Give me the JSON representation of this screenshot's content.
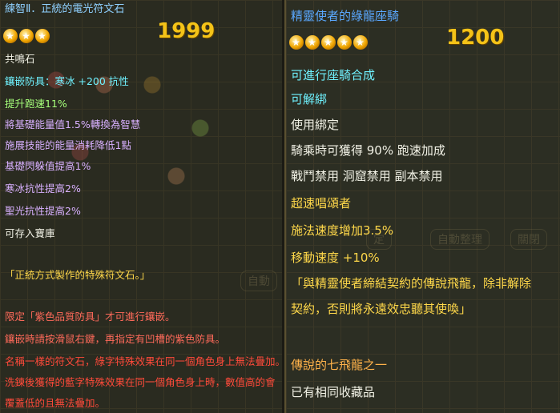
{
  "left": {
    "title": "練智Ⅱ．正統的電光符文石",
    "stars": 3,
    "count_badge": "1999",
    "lines": [
      {
        "text": "共鳴石",
        "color": "white"
      },
      {
        "text": "鑲嵌防具：寒冰 +200 抗性",
        "color": "cyan"
      },
      {
        "text": "提升跑速11%",
        "color": "green"
      },
      {
        "text": "將基礎能量值1.5%轉換為智慧",
        "color": "purple"
      },
      {
        "text": "施展技能的能量消耗降低1點",
        "color": "purple"
      },
      {
        "text": "基礎閃躲值提高1%",
        "color": "purple"
      },
      {
        "text": "寒冰抗性提高2%",
        "color": "purple"
      },
      {
        "text": "聖光抗性提高2%",
        "color": "purple"
      },
      {
        "text": "可存入寶庫",
        "color": "white"
      },
      {
        "text": "「正統方式製作的特殊符文石。」",
        "color": "yellow"
      },
      {
        "text": "限定「紫色品質防具」才可進行鑲嵌。",
        "color": "red"
      },
      {
        "text": "鑲嵌時請按滑鼠右鍵，再指定有凹槽的紫色防具。",
        "color": "red"
      },
      {
        "text": "名稱一樣的符文石，綠字特殊效果在同一個角色身上無法疊加。",
        "color": "red"
      },
      {
        "text": "洗鍊後獲得的藍字特殊效果在同一個角色身上時，數值高的會",
        "color": "red"
      },
      {
        "text": "覆蓋低的且無法疊加。",
        "color": "red"
      }
    ],
    "bg_button": "自動"
  },
  "right": {
    "title": "精靈使者的綠龍座騎",
    "stars": 5,
    "count_badge": "1200",
    "lines": [
      {
        "text": "可進行座騎合成",
        "color": "cyan"
      },
      {
        "text": "可解綁",
        "color": "cyan"
      },
      {
        "text": "使用綁定",
        "color": "white"
      },
      {
        "text": "騎乘時可獲得 90% 跑速加成",
        "color": "white"
      },
      {
        "text": "戰鬥禁用 洞窟禁用 副本禁用",
        "color": "white"
      },
      {
        "text": "超速唱頌者",
        "color": "yellow"
      },
      {
        "text": "施法速度增加3.5%",
        "color": "yellow"
      },
      {
        "text": "移動速度 +10%",
        "color": "yellow"
      },
      {
        "text": "「與精靈使者締結契約的傳說飛龍，除非解除",
        "color": "yellow"
      },
      {
        "text": "契約，否則將永遠效忠聽其使喚」",
        "color": "yellow"
      },
      {
        "text": "傳說的七飛龍之一",
        "color": "orange"
      },
      {
        "text": "已有相同收藏品",
        "color": "white"
      }
    ],
    "bg_buttons": [
      "定",
      "自動整理",
      "關閉"
    ]
  }
}
